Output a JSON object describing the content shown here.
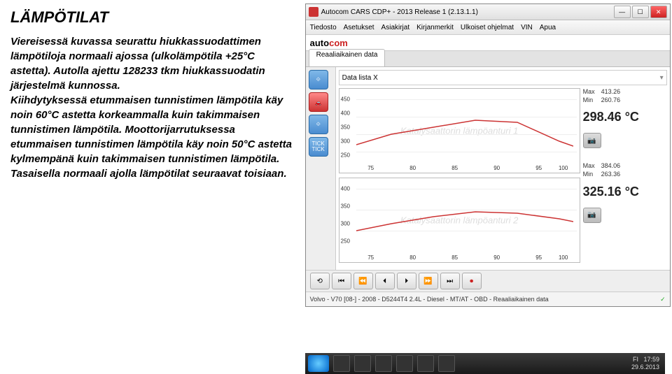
{
  "left": {
    "title": "LÄMPÖTILAT",
    "body": "Viereisessä kuvassa seurattu hiukkassuodattimen lämpötiloja normaali ajossa (ulkolämpötila +25°C astetta). Autolla ajettu 128233 tkm hiukkassuodatin järjestelmä kunnossa.\nKiihdytyksessä etummaisen tunnistimen lämpötila käy noin 60°C astetta korkeammalla kuin takimmaisen tunnistimen lämpötila. Moottorijarrutuksessa etummaisen tunnistimen lämpötila käy noin 50°C astetta kylmempänä kuin takimmaisen tunnistimen lämpötila. Tasaisella normaali ajolla lämpötilat seuraavat toisiaan."
  },
  "window": {
    "title": "Autocom CARS CDP+ - 2013 Release 1 (2.13.1.1)",
    "menus": [
      "Tiedosto",
      "Asetukset",
      "Asiakirjat",
      "Kirjanmerkit",
      "Ulkoiset ohjelmat",
      "VIN",
      "Apua"
    ],
    "brand_a": "auto",
    "brand_b": "com",
    "tab": "Reaaliaikainen data",
    "datalist": "Data lista X",
    "sidebar": [
      "⟐",
      "🚗",
      "⟐",
      "TICK TICK"
    ],
    "status": "Volvo - V70 [08-] - 2008 - D5244T4 2.4L - Diesel - MT/AT - OBD - Reaaliaikainen data"
  },
  "chart_data": [
    {
      "type": "line",
      "title": "Katalysaattorin lämpöanturi 1",
      "x": [
        75,
        80,
        85,
        90,
        95,
        100
      ],
      "ylim": [
        250,
        450
      ],
      "yticks": [
        250,
        300,
        350,
        400,
        450
      ],
      "values": [
        300,
        330,
        350,
        370,
        365,
        310
      ],
      "max_label": "Max",
      "max": 413.26,
      "min_label": "Min",
      "min": 260.76,
      "current": "298.46 °C"
    },
    {
      "type": "line",
      "title": "Katalysaattorin lämpöanturi 2",
      "x": [
        75,
        80,
        85,
        90,
        95,
        100
      ],
      "ylim": [
        250,
        400
      ],
      "yticks": [
        250,
        300,
        350,
        400
      ],
      "values": [
        300,
        320,
        340,
        355,
        350,
        330
      ],
      "max_label": "Max",
      "max": 384.06,
      "min_label": "Min",
      "min": 263.36,
      "current": "325.16 °C"
    }
  ],
  "transport": [
    "⟲",
    "⏮",
    "⏪",
    "⏴",
    "⏵",
    "⏩",
    "⏭",
    "⏺"
  ],
  "taskbar": {
    "time": "17:59",
    "date": "29.6.2013",
    "lang": "FI"
  }
}
